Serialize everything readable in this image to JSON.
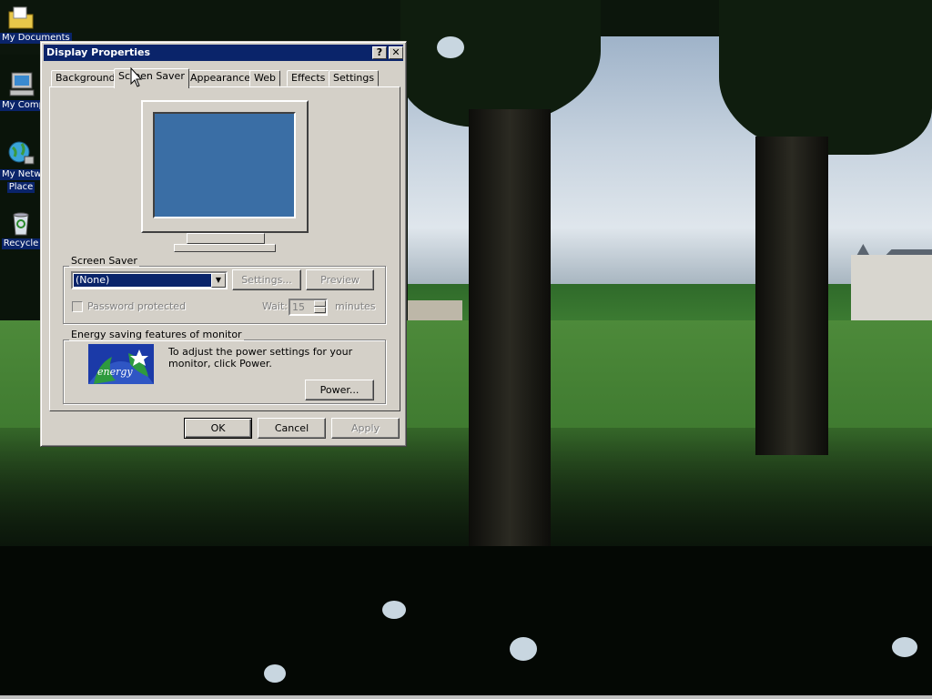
{
  "desktop": {
    "icons": [
      {
        "name": "my-documents-icon",
        "label": "My Documents"
      },
      {
        "name": "my-computer-icon",
        "label": "My Comp"
      },
      {
        "name": "my-network-places-icon",
        "label_line1": "My Netw",
        "label_line2": "Place"
      },
      {
        "name": "recycle-bin-icon",
        "label": "Recycle"
      }
    ]
  },
  "dialog": {
    "title": "Display Properties",
    "help_button": "?",
    "close_button": "✕",
    "tabs": [
      {
        "label": "Background"
      },
      {
        "label": "Screen Saver",
        "active": true
      },
      {
        "label": "Appearance"
      },
      {
        "label": "Web"
      },
      {
        "label": "Effects"
      },
      {
        "label": "Settings"
      }
    ],
    "screen_saver": {
      "group_label": "Screen Saver",
      "selected": "(None)",
      "settings_button": "Settings...",
      "preview_button": "Preview",
      "password_label": "Password protected",
      "password_checked": false,
      "wait_label": "Wait:",
      "wait_value": "15",
      "minutes_label": "minutes"
    },
    "energy": {
      "group_label": "Energy saving features of monitor",
      "logo_text": "energy",
      "description": "To adjust the power settings for your monitor, click Power.",
      "power_button": "Power..."
    },
    "footer": {
      "ok": "OK",
      "cancel": "Cancel",
      "apply": "Apply"
    },
    "preview_color": "#3a6ea5"
  },
  "colors": {
    "titlebar": "#0a246a",
    "face": "#d4d0c8"
  }
}
